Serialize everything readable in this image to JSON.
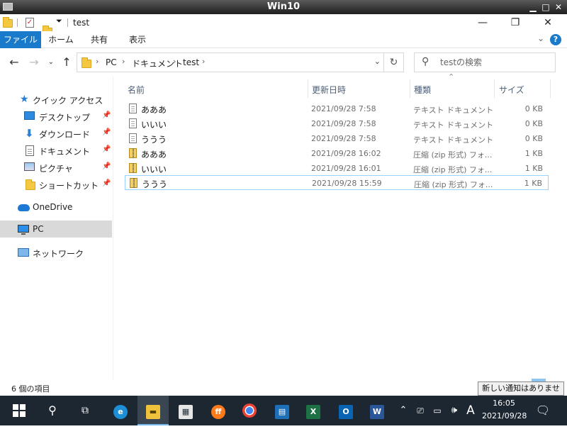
{
  "outer_window": {
    "title": "Win10"
  },
  "explorer": {
    "title": "test",
    "caption": {
      "minimize": "—",
      "maximize": "❐",
      "close": "✕"
    }
  },
  "ribbon": {
    "tabs": [
      {
        "label": "ファイル",
        "active": true
      },
      {
        "label": "ホーム"
      },
      {
        "label": "共有"
      },
      {
        "label": "表示"
      }
    ],
    "expand_icon": "chevron-down-icon",
    "help_icon": "help-icon",
    "help_glyph": "?"
  },
  "address": {
    "breadcrumbs": [
      "PC",
      "ドキュメント",
      "test"
    ],
    "separator": "›",
    "dropdown_glyph": "⌄"
  },
  "search": {
    "placeholder": "testの検索"
  },
  "nav_pane": {
    "items": [
      {
        "label": "クイック アクセス",
        "icon": "star-icon"
      },
      {
        "label": "デスクトップ",
        "icon": "desktop-icon",
        "pinned": true
      },
      {
        "label": "ダウンロード",
        "icon": "download-icon",
        "pinned": true
      },
      {
        "label": "ドキュメント",
        "icon": "documents-icon",
        "pinned": true
      },
      {
        "label": "ピクチャ",
        "icon": "pictures-icon",
        "pinned": true
      },
      {
        "label": "ショートカット",
        "icon": "folder-icon",
        "pinned": true
      },
      {
        "label": "OneDrive",
        "icon": "onedrive-icon"
      },
      {
        "label": "PC",
        "icon": "pc-icon",
        "selected": true
      },
      {
        "label": "ネットワーク",
        "icon": "network-icon"
      }
    ]
  },
  "file_list": {
    "columns": [
      "名前",
      "更新日時",
      "種類",
      "サイズ"
    ],
    "rows": [
      {
        "name": "あああ",
        "date": "2021/09/28 7:58",
        "type": "テキスト ドキュメント",
        "size": "0 KB",
        "icon": "text-file-icon"
      },
      {
        "name": "いいい",
        "date": "2021/09/28 7:58",
        "type": "テキスト ドキュメント",
        "size": "0 KB",
        "icon": "text-file-icon"
      },
      {
        "name": "ううう",
        "date": "2021/09/28 7:58",
        "type": "テキスト ドキュメント",
        "size": "0 KB",
        "icon": "text-file-icon"
      },
      {
        "name": "あああ",
        "date": "2021/09/28 16:02",
        "type": "圧縮 (zip 形式) フォ...",
        "size": "1 KB",
        "icon": "zip-file-icon"
      },
      {
        "name": "いいい",
        "date": "2021/09/28 16:01",
        "type": "圧縮 (zip 形式) フォ...",
        "size": "1 KB",
        "icon": "zip-file-icon"
      },
      {
        "name": "ううう",
        "date": "2021/09/28 15:59",
        "type": "圧縮 (zip 形式) フォ...",
        "size": "1 KB",
        "icon": "zip-file-icon",
        "selected": true
      }
    ]
  },
  "status_bar": {
    "item_count": "6 個の項目"
  },
  "notification_toast": "新しい通知はありません",
  "taskbar": {
    "apps": [
      "start-icon",
      "search-icon",
      "task-view-icon",
      "edge-icon",
      "file-explorer-icon",
      "store-icon",
      "firefox-icon",
      "chrome-icon",
      "outlook-contacts-icon",
      "excel-icon",
      "outlook-icon",
      "word-icon"
    ],
    "ime_indicator": "A",
    "clock": {
      "time": "16:05",
      "date": "2021/09/28"
    }
  },
  "colors": {
    "accent": "#1979ca",
    "taskbar": "#1d2731",
    "selection_border": "#99d1ff",
    "nav_selected": "#d9d9d9"
  }
}
